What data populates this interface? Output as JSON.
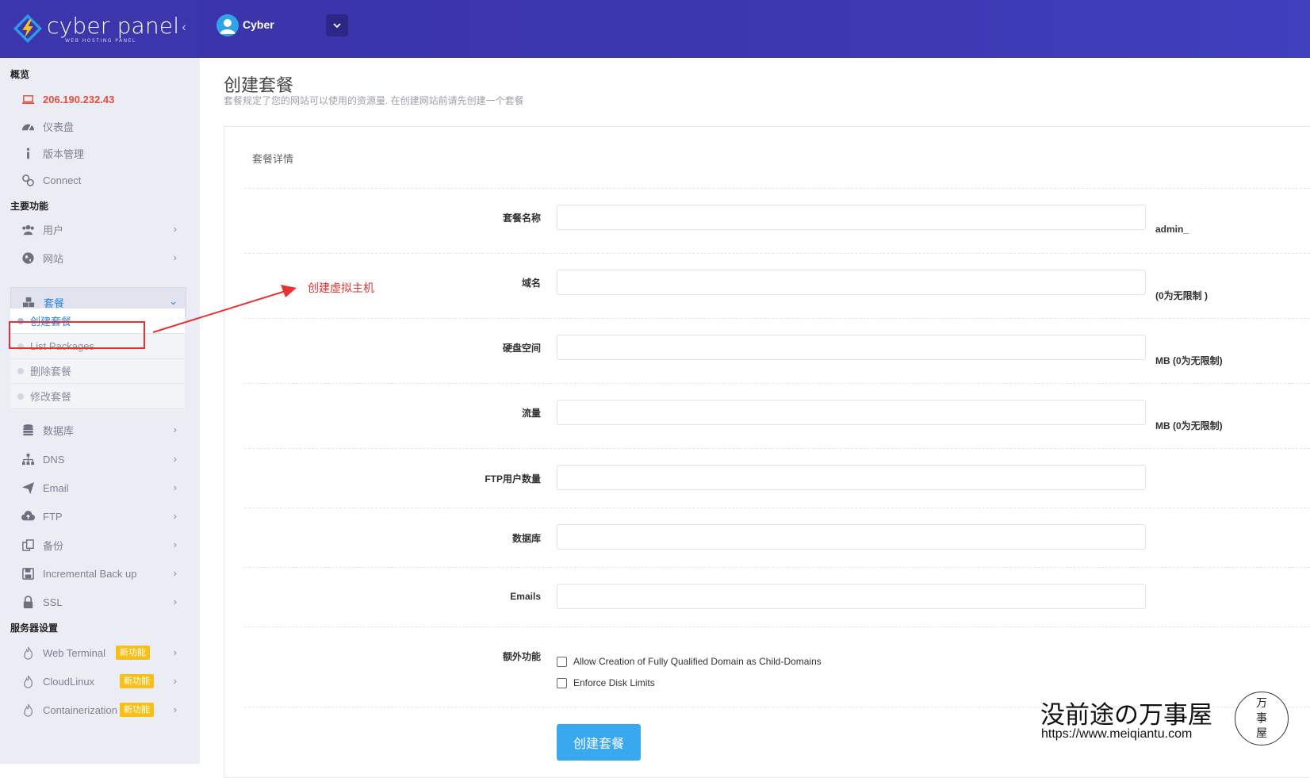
{
  "colors": {
    "header_bg": "#3c36ac",
    "sidebar_bg": "#ecedf4",
    "link_active": "#2a86d6",
    "ip_text": "#e74c3c",
    "badge_new": "#f6c018",
    "button_primary": "#39a9ef",
    "annotation_red": "#e63232"
  },
  "brand": {
    "name": "cyber panel",
    "tagline": "WEB HOSTING PANEL",
    "collapse_icon": "chevron-left-icon"
  },
  "header": {
    "user_name": "Cyber",
    "dropdown_icon": "chevron-down-icon"
  },
  "sidebar": {
    "section_overview": "概览",
    "ip": "206.190.232.43",
    "dashboard": "仪表盘",
    "version": "版本管理",
    "connect": "Connect",
    "section_main": "主要功能",
    "users": "用户",
    "websites": "网站",
    "packages": "套餐",
    "packages_sub": {
      "create": "创建套餐",
      "list": "List Packages",
      "delete": "删除套餐",
      "modify": "修改套餐"
    },
    "databases": "数据库",
    "dns": "DNS",
    "email": "Email",
    "ftp": "FTP",
    "backup": "备份",
    "incremental_backup": "Incremental Back up",
    "ssl": "SSL",
    "section_server": "服务器设置",
    "web_terminal": "Web Terminal",
    "cloudlinux": "CloudLinux",
    "containerization": "Containerization",
    "new_badge": "新功能"
  },
  "page": {
    "title": "创建套餐",
    "subtitle": "套餐规定了您的网站可以使用的资源量. 在创建网站前请先创建一个套餐"
  },
  "form": {
    "card_title": "套餐详情",
    "package_name": {
      "label": "套餐名称",
      "value": "",
      "hint": "admin_"
    },
    "domains": {
      "label": "域名",
      "value": "",
      "hint": "(0为无限制 )"
    },
    "disk_space": {
      "label": "硬盘空间",
      "value": "",
      "hint": "MB (0为无限制)"
    },
    "bandwidth": {
      "label": "流量",
      "value": "",
      "hint": "MB (0为无限制)"
    },
    "ftp_accounts": {
      "label": "FTP用户数量",
      "value": ""
    },
    "databases": {
      "label": "数据库",
      "value": ""
    },
    "emails": {
      "label": "Emails",
      "value": ""
    },
    "extra": {
      "label": "额外功能",
      "allow_fqdn": {
        "label": "Allow Creation of Fully Qualified Domain as Child-Domains",
        "checked": false
      },
      "enforce_disk": {
        "label": "Enforce Disk Limits",
        "checked": false
      }
    },
    "submit_label": "创建套餐"
  },
  "annotation": {
    "text": "创建虚拟主机"
  },
  "watermark": {
    "text": "没前途の万事屋",
    "url": "https://www.meiqiantu.com",
    "seal_chars": [
      "万",
      "事",
      "屋"
    ]
  }
}
